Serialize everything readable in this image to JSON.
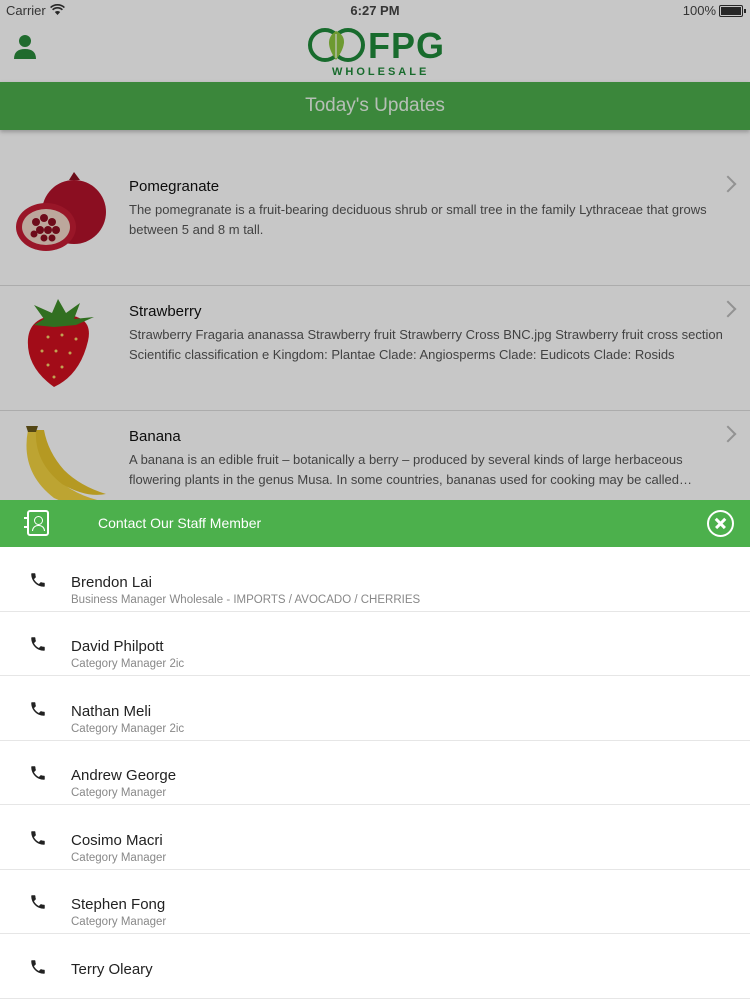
{
  "status_bar": {
    "carrier": "Carrier",
    "time": "6:27 PM",
    "battery": "100%"
  },
  "header": {
    "logo_brand": "FPG",
    "logo_sub": "WHOLESALE",
    "title": "Today's Updates"
  },
  "updates": [
    {
      "title": "Pomegranate",
      "description": "The pomegranate is a fruit-bearing deciduous shrub or small tree in the family Lythraceae that grows between 5 and 8 m tall.",
      "image": "pomegranate"
    },
    {
      "title": "Strawberry",
      "description": "Strawberry Fragaria ananassa Strawberry fruit Strawberry Cross BNC.jpg Strawberry fruit cross section Scientific classification e Kingdom: Plantae Clade: Angiosperms Clade: Eudicots Clade: Rosids",
      "image": "strawberry"
    },
    {
      "title": "Banana",
      "description": "A banana is an edible fruit – botanically a berry – produced by several kinds of large herbaceous flowering plants in the genus Musa. In some countries, bananas used for cooking may be called plantains",
      "image": "banana"
    }
  ],
  "contact_sheet": {
    "title": "Contact Our Staff Member",
    "staff": [
      {
        "name": "Brendon Lai",
        "role": "Business Manager Wholesale - IMPORTS / AVOCADO / CHERRIES"
      },
      {
        "name": "David Philpott",
        "role": "Category Manager 2ic"
      },
      {
        "name": "Nathan Meli",
        "role": "Category Manager 2ic"
      },
      {
        "name": "Andrew George",
        "role": "Category Manager"
      },
      {
        "name": "Cosimo Macri",
        "role": "Category Manager"
      },
      {
        "name": "Stephen Fong",
        "role": "Category Manager"
      },
      {
        "name": "Terry Oleary",
        "role": ""
      }
    ]
  },
  "colors": {
    "brand_green": "#4cae4c",
    "logo_green": "#1f8a3a"
  }
}
